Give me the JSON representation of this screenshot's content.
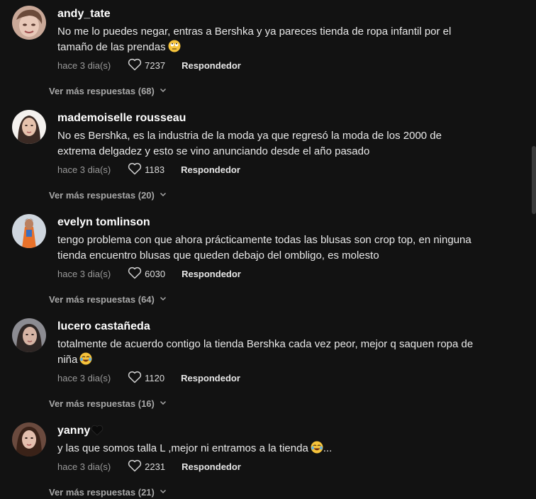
{
  "comments": [
    {
      "username": "andy_tate",
      "text": "No me lo puedes negar, entras a Bershka y ya pareces tienda de ropa infantil por el tamaño de las prendas",
      "time": "hace 3 dia(s)",
      "likes": "7237",
      "reply_label": "Respondedor",
      "more_replies": "Ver más respuestas (68)",
      "emoji": "face-with-rolling-eyes-icon"
    },
    {
      "username": "mademoiselle rousseau",
      "text": "No es Bershka, es la industria de la moda ya que regresó la moda de los 2000 de extrema delgadez y esto se vino anunciando desde el año pasado",
      "time": "hace 3 dia(s)",
      "likes": "1183",
      "reply_label": "Respondedor",
      "more_replies": "Ver más respuestas (20)"
    },
    {
      "username": "evelyn tomlinson",
      "text": "tengo problema con que ahora prácticamente todas las blusas son crop top, en ninguna tienda encuentro blusas que queden debajo del ombligo, es molesto",
      "time": "hace 3 dia(s)",
      "likes": "6030",
      "reply_label": "Respondedor",
      "more_replies": "Ver más respuestas (64)"
    },
    {
      "username": "lucero castañeda",
      "text": "totalmente de acuerdo contigo la tienda Bershka cada vez peor, mejor q saquen ropa de niña",
      "time": "hace 3 dia(s)",
      "likes": "1120",
      "reply_label": "Respondedor",
      "more_replies": "Ver más respuestas (16)",
      "emoji": "face-with-tears-of-joy-icon"
    },
    {
      "username": "yanny",
      "text": "y las que somos talla L ,mejor ni entramos a la tienda",
      "text_suffix": "...",
      "time": "hace 3 dia(s)",
      "likes": "2231",
      "reply_label": "Respondedor",
      "more_replies": "Ver más respuestas (21)",
      "emoji": "face-with-tears-of-joy-icon",
      "username_emoji": "black-heart-icon"
    }
  ],
  "colors": {
    "background": "#121212",
    "username": "#ffffff",
    "text": "#e8e8e8",
    "meta": "#9a9a9a"
  }
}
